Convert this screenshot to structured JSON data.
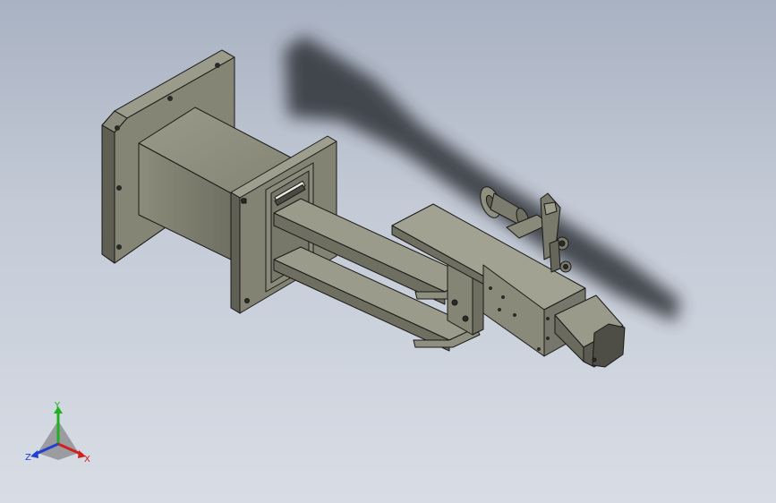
{
  "triad": {
    "x_label": "X",
    "y_label": "Y",
    "z_label": "Z",
    "x_color": "#d02020",
    "y_color": "#20b020",
    "z_color": "#2040d0"
  },
  "colors": {
    "part_face_light": "#8f8f80",
    "part_face_mid": "#7a7a6c",
    "part_face_dark": "#5f5f54",
    "edge": "#1a1a18",
    "shadow": "#3a3f48"
  }
}
